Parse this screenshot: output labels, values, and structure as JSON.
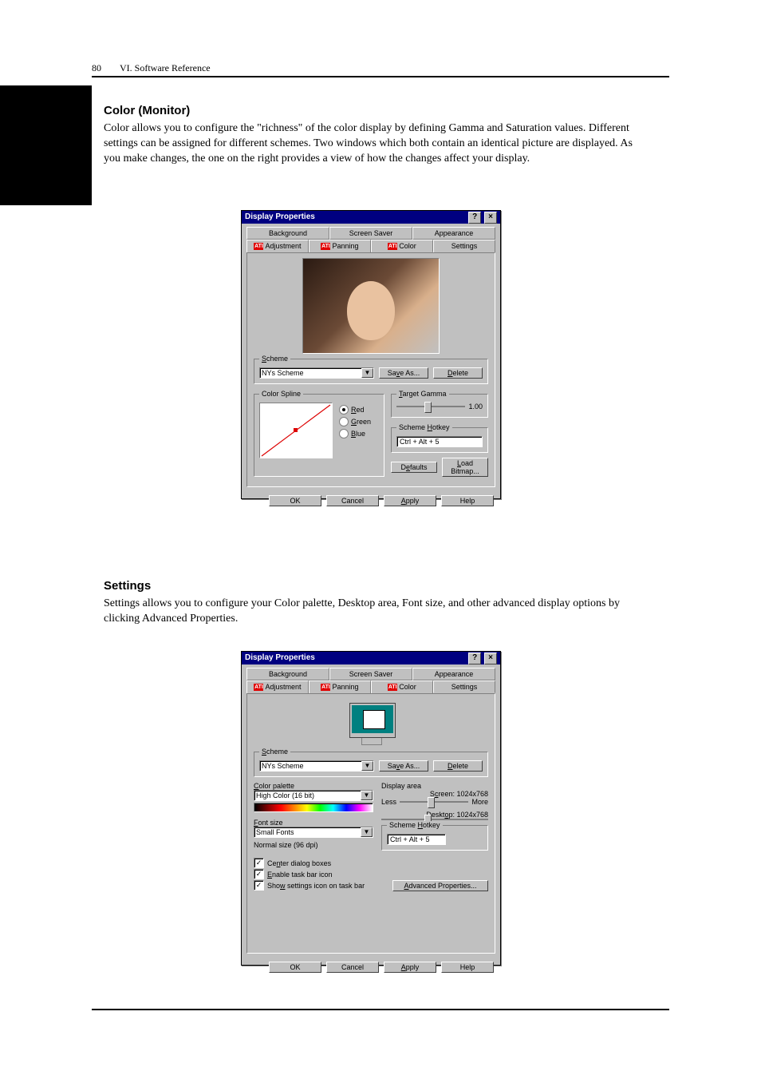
{
  "page": {
    "number": "80",
    "chapter": "VI. Software Reference"
  },
  "sections": {
    "color_heading": "Color (Monitor)",
    "color_body": "Color allows you to configure the \"richness\" of the color display by defining Gamma and Saturation values. Different settings can be assigned for different schemes. Two windows which both contain an identical picture are displayed. As you make changes, the one on the right provides a view of how the changes affect your display.",
    "settings_heading": "Settings",
    "settings_body": "Settings allows you to configure your Color palette, Desktop area, Font size, and other advanced display options by clicking Advanced Properties."
  },
  "dlg1": {
    "title": "Display Properties",
    "tabs_row1": [
      "Background",
      "Screen Saver",
      "Appearance"
    ],
    "tabs_row2": [
      "Adjustment",
      "Panning",
      "Color",
      "Settings"
    ],
    "ati_icon_text": "ATI",
    "scheme": {
      "legend": "Scheme",
      "value": "NYs Scheme",
      "save_as": "Save As...",
      "delete": "Delete"
    },
    "color_spline": {
      "legend": "Color Spline",
      "red": "Red",
      "green": "Green",
      "blue": "Blue"
    },
    "target_gamma": {
      "legend": "Target Gamma",
      "value": "1.00"
    },
    "scheme_hotkey": {
      "legend": "Scheme Hotkey",
      "value": "Ctrl + Alt + 5"
    },
    "defaults": "Defaults",
    "load_bitmap": "Load Bitmap...",
    "buttons": {
      "ok": "OK",
      "cancel": "Cancel",
      "apply": "Apply",
      "help": "Help"
    }
  },
  "dlg2": {
    "title": "Display Properties",
    "tabs_row1": [
      "Background",
      "Screen Saver",
      "Appearance"
    ],
    "tabs_row2": [
      "Adjustment",
      "Panning",
      "Color",
      "Settings"
    ],
    "scheme": {
      "legend": "Scheme",
      "value": "NYs Scheme",
      "save_as": "Save As...",
      "delete": "Delete"
    },
    "color_palette": {
      "label": "Color palette",
      "value": "High Color (16 bit)"
    },
    "display_area": {
      "label": "Display area",
      "screen_label": "Screen: 1024x768",
      "less": "Less",
      "more": "More",
      "desktop_label": "Desktop: 1024x768"
    },
    "font_size": {
      "label": "Font size",
      "value": "Small Fonts",
      "normal": "Normal size (96 dpi)"
    },
    "scheme_hotkey": {
      "legend": "Scheme Hotkey",
      "value": "Ctrl + Alt + 5"
    },
    "checks": {
      "center": "Center dialog boxes",
      "taskbar": "Enable task bar icon",
      "show_icon": "Show settings icon on task bar"
    },
    "advanced": "Advanced Properties...",
    "buttons": {
      "ok": "OK",
      "cancel": "Cancel",
      "apply": "Apply",
      "help": "Help"
    }
  },
  "icons": {
    "help": "?",
    "close": "×",
    "dropdown": "▼",
    "check": "✓"
  }
}
